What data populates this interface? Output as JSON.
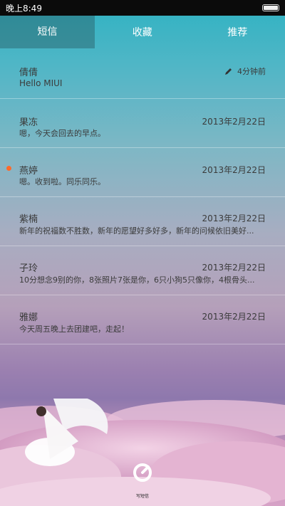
{
  "statusbar": {
    "time": "晚上8:49"
  },
  "tabs": [
    {
      "label": "短信"
    },
    {
      "label": "收藏"
    },
    {
      "label": "推荐"
    }
  ],
  "messages": [
    {
      "name": "倩倩",
      "time": "4分钟前",
      "preview": "Hello MIUI"
    },
    {
      "name": "果冻",
      "time": "2013年2月22日",
      "preview": "嗯，今天会回去的早点。"
    },
    {
      "name": "燕婷",
      "time": "2013年2月22日",
      "preview": "嗯。收到啦。同乐同乐。",
      "unread": true
    },
    {
      "name": "紫楠",
      "time": "2013年2月22日",
      "preview": "新年的祝福数不胜数，新年的愿望好多好多，新年的问候依旧美好..."
    },
    {
      "name": "子玲",
      "time": "2013年2月22日",
      "preview": "10分想念9别的你，8张照片7张是你，6只小狗5只像你，4根骨头..."
    },
    {
      "name": "雅娜",
      "time": "2013年2月22日",
      "preview": "今天周五晚上去团建吧，走起！"
    }
  ],
  "compose": {
    "label": "写短信"
  },
  "colors": {
    "unread_dot": "#ff6a2a",
    "text": "#3b3b3b",
    "statusbar": "#0b0b0b"
  }
}
